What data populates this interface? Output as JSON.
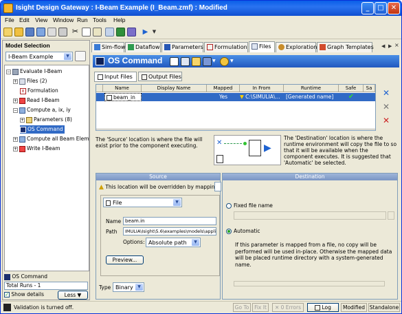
{
  "window": {
    "title": "Isight Design Gateway : I-Beam Example (I_Beam.zmf) : Modified"
  },
  "menu": [
    "File",
    "Edit",
    "View",
    "Window",
    "Run",
    "Tools",
    "Help"
  ],
  "left": {
    "header": "Model Selection",
    "model_combo": "I-Beam Example",
    "tree": [
      {
        "label": "Evaluate I-Beam"
      },
      {
        "label": "Files (2)"
      },
      {
        "label": "Formulation"
      },
      {
        "label": "Read I-Beam"
      },
      {
        "label": "Compute a, ix, iy"
      },
      {
        "label": "Parameters (8)"
      },
      {
        "label": "OS Command"
      },
      {
        "label": "Compute all Beam Elemen"
      },
      {
        "label": "Write I-Beam"
      }
    ],
    "bottom": {
      "component": "OS Command",
      "total_runs": "Total Runs - 1",
      "show_details": "Show details",
      "less": "Less"
    }
  },
  "tabs": [
    "Sim-flow",
    "Dataflow",
    "Parameters",
    "Formulation",
    "Files",
    "Exploration",
    "Graph Templates"
  ],
  "os": {
    "title": "OS Command"
  },
  "subtabs": [
    "Input Files",
    "Output Files"
  ],
  "grid": {
    "headers": [
      "Name",
      "Display Name",
      "Mapped",
      "In From",
      "Runtime",
      "Safe",
      "Sa"
    ],
    "row": {
      "name": "beam_in",
      "mapped": "Yes",
      "in_from": "C:\\SIMULIA\\...",
      "runtime": "[Generated name]"
    }
  },
  "desc": {
    "left": "The 'Source' location is where the file will exist prior to the component executing.",
    "right": "The 'Destination' location is where the runtime environment will copy the file to so that it will be available when the component executes. It is suggested that 'Automatic' be selected."
  },
  "source": {
    "header": "Source",
    "warning": "This location will be overridden by mapping.",
    "type_combo": "File",
    "name_label": "Name",
    "name_value": "beam.in",
    "path_label": "Path",
    "path_value": "IMULIA\\Isight\\5.6\\examples\\models\\applicatio",
    "options_label": "Options:",
    "options_value": "Absolute path",
    "preview": "Preview...",
    "type_label": "Type",
    "type_value": "Binary"
  },
  "destination": {
    "header": "Destination",
    "fixed": "Fixed file name",
    "automatic": "Automatic",
    "auto_text": "If this parameter is mapped from a file, no copy will be performed will be used in-place.  Otherwise the mapped data will be placed runtime directory with a system-generated name."
  },
  "status": {
    "message": "Validation is turned off.",
    "goto": "Go To",
    "fixit": "Fix It",
    "errors": "0 Errors",
    "log": "Log",
    "modified": "Modified",
    "standalone": "Standalone"
  }
}
